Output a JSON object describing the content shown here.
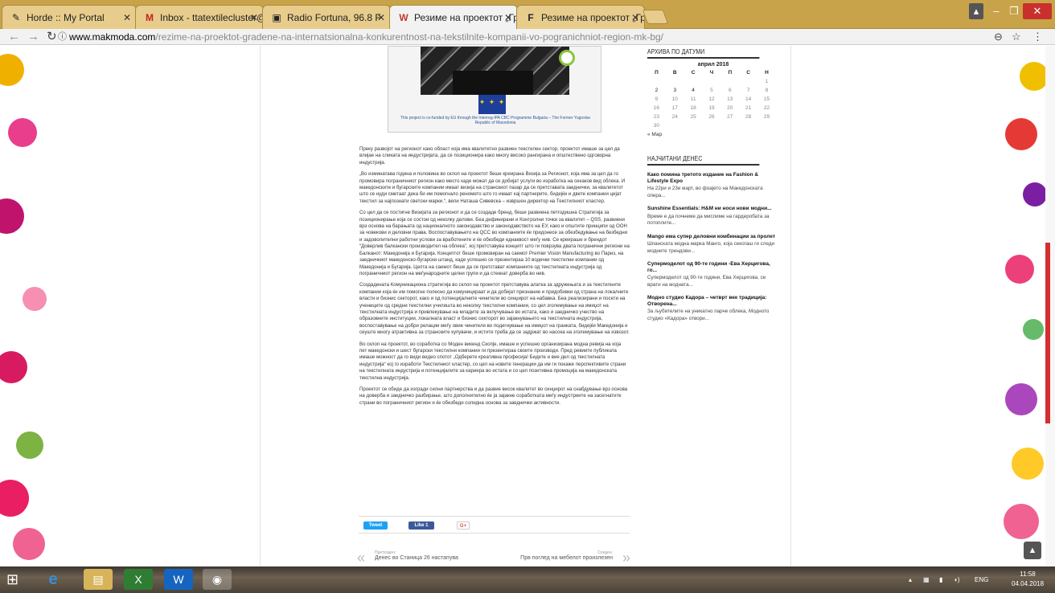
{
  "tabs": [
    {
      "title": "Horde :: My Portal",
      "icon": "horde-icon"
    },
    {
      "title": "Inbox - ttatextilecluster@",
      "icon": "gmail-icon"
    },
    {
      "title": "Radio Fortuna, 96.8 F",
      "icon": "radio-icon"
    },
    {
      "title": "Резиме на проектот „Гр",
      "icon": "makmoda-icon"
    },
    {
      "title": "Резиме на проектот „Гр",
      "icon": "facebook-icon"
    }
  ],
  "address": {
    "host": "www.makmoda.com",
    "path": "/rezime-na-proektot-gradene-na-internatsionalna-konkurentnost-na-tekstilnite-kompanii-vo-pogranichniot-region-mk-bg/"
  },
  "hero": {
    "caption": "This project is co-funded by EU through the Interreg-IPA CBC Programme Bulgaria – The Former Yugoslav Republic of Macedonia"
  },
  "article": [
    "Преку развојот на регионот како област која има квалитетно развиен текстилен сектор, проектот имаше за цел да влијае на сликата на индустријата, да се позиционира како многу високо рангирана и општествено одговорна индустрија.",
    "„Во изминатава година и половина во склоп на проектот беше креирана Визија за Регионот, која има за цел да го промовира пограничниот регион како место каде можат да се добијат услуги во изработка на секаков вид облека. И македонските и бугарските компании имаат визија на странскиот пазар да се претставата заеднички, за квалитетот што се нуди сметаат дека би им помогнало реномето што го имаат кај партнерите, бидејќи и двете компании цијат текстил за најпознати светски марки.“, вели Наташа Сивевска – извршен директор на Текстилниот кластер.",
    "Со цел да се постигне Визијата за регионот и да се создаде бренд, беше развиена петгодишна Стратегија за позиционирање која се состои од неколку делови. Беа дефинирани и Контролни точки за квалитет – QSS, развиени врз основа на барањата од националното законодавство и законодавството на ЕУ, како и општите принципи од ООН за човекови и деловни права. Воспоставувањето на QCC во компаниите ќе придонесе за обезбедување на безбедни и задоволителни работни услови за вработените и ќе обезбеди еднаквост меѓу нив. Се креираше и брендот “Доверлив балкански производител на облека”, кој претставува концепт што ги поврзува двата погранични региони на Балканот: Македонија и Бугарија. Концептот беше промовиран на саемот Premier Vision Manufacturing во Париз, на заедничкиот македонско-бугарски штанд, каде успешно се презентираа 10 водечки текстилни компании од Македонија и Бугарија. Целта на саемот беше да се претстават компаниите од текстилната индустрија од пограничниот регион на меѓународните целни групи и да стекнат доверба во нив.",
    "Создадената Комуникациона стратегија во склоп на проектот претставува алатка за здружењата и за текстилните компании која ќе им помогне полесно да комуницираат и да добијат признание и придобивки од страна на локалните власти и бизнис секторот, како и од потенцијалните чинители во синџирот на набавка. Беа реализирани и посети на учениците од средни текстилни училишта во неколку текстилни компании, со цел зголемување на имиџот на текстилната индустрија и привлекување на младите за вклучување во истата, како и заедничко учество на образовните институции, локалната власт и бизнис секторот во зајакнувањето на текстилната индустрија, воспоставување на добри релации меѓу овие чинители во подигнување на имиџот на гранката, бидејќи Македонија е сеуште многу атрактивна за странските купувачи, и истите треба да се задржат во насока на зголемување на извозот.",
    "Во склоп на проектот, во соработка со Моден викенд Скопје, имаше и успешно организирана модна ревија на која пет македонски и шест бугарски текстилни компании ги презентираа своите производи. Пред ревиите публиката имаше можност да го види видео спотот „Одберете креативна професија! Бидете и вие дел од текстилната индустрија“ кој го изработи Текстилниот кластер, со цел на новите генерации да им ги покаже перспективите страни на текстилната индустрија и потенцијалите за кариера во истата и со цел позитивна промоција на македонската текстилна индустрија.",
    "Проектот се обиде да изгради силни партнерства и да развие висок квалитет во синџирот на снабдување врз основа на доверба и заедничко разбирање, што дополнително ќе ја зајакне соработката меѓу индустриите на засегнатите страни во пограничниот регион и ќе обезбеди солидна основа за заеднички активности."
  ],
  "share": {
    "tweet": "Tweet",
    "like": "Like 1",
    "gplus": "G+"
  },
  "post_nav": {
    "prev_label": "Претходен:",
    "prev_title": "Денес во Станица 26 настапува",
    "next_label": "Следен:",
    "next_title": "Прв поглед на мебелот произлезен"
  },
  "sidebar": {
    "archive_title": "АРХИВА ПО ДАТУМИ",
    "calendar": {
      "month": "април 2018",
      "weekdays": [
        "П",
        "В",
        "С",
        "Ч",
        "П",
        "С",
        "Н"
      ],
      "weeks": [
        [
          "",
          "",
          "",
          "",
          "",
          "",
          "1"
        ],
        [
          "2",
          "3",
          "4",
          "5",
          "6",
          "7",
          "8"
        ],
        [
          "9",
          "10",
          "11",
          "12",
          "13",
          "14",
          "15"
        ],
        [
          "16",
          "17",
          "18",
          "19",
          "20",
          "21",
          "22"
        ],
        [
          "23",
          "24",
          "25",
          "26",
          "27",
          "28",
          "29"
        ],
        [
          "30",
          "",
          "",
          "",
          "",
          "",
          ""
        ]
      ],
      "prev": "« Мар"
    },
    "popular_title": "НАЈЧИТАНИ ДЕНЕС",
    "popular": [
      {
        "title": "Како помина третото издание на Fashion & Lifestyle Expo",
        "excerpt": "На 22ри и 23и март, во фоајето на Македонската опера..."
      },
      {
        "title": "Sunshine Essentials: H&M ни носи нови модни...",
        "excerpt": "Време е да почнеме да мислиме на гардеробата за потоплите..."
      },
      {
        "title": "Mango има супер деловни комбинации за пролет",
        "excerpt": "Шпанската модна марка Манго, која секогаш ги следи модните трендови..."
      },
      {
        "title": "Супермоделот од 90-те години -Ева Херцигова, го...",
        "excerpt": "Супермоделот од 90-те години, Ева Херцигова, се врати на модната..."
      },
      {
        "title": "Модно студио Кадора – четврт век традиција: Отворена...",
        "excerpt": "За љубителите на уникатно парче облека, Модното студио «Кадора» отвори..."
      }
    ]
  },
  "taskbar": {
    "lang": "ENG",
    "time": "11:58",
    "date": "04.04.2018"
  },
  "colors": {
    "tabstrip": "#c9a34a",
    "accent": "#d32f2f",
    "twitter": "#1da1f2",
    "facebook": "#3b5998",
    "gplus": "#dd4b39"
  }
}
